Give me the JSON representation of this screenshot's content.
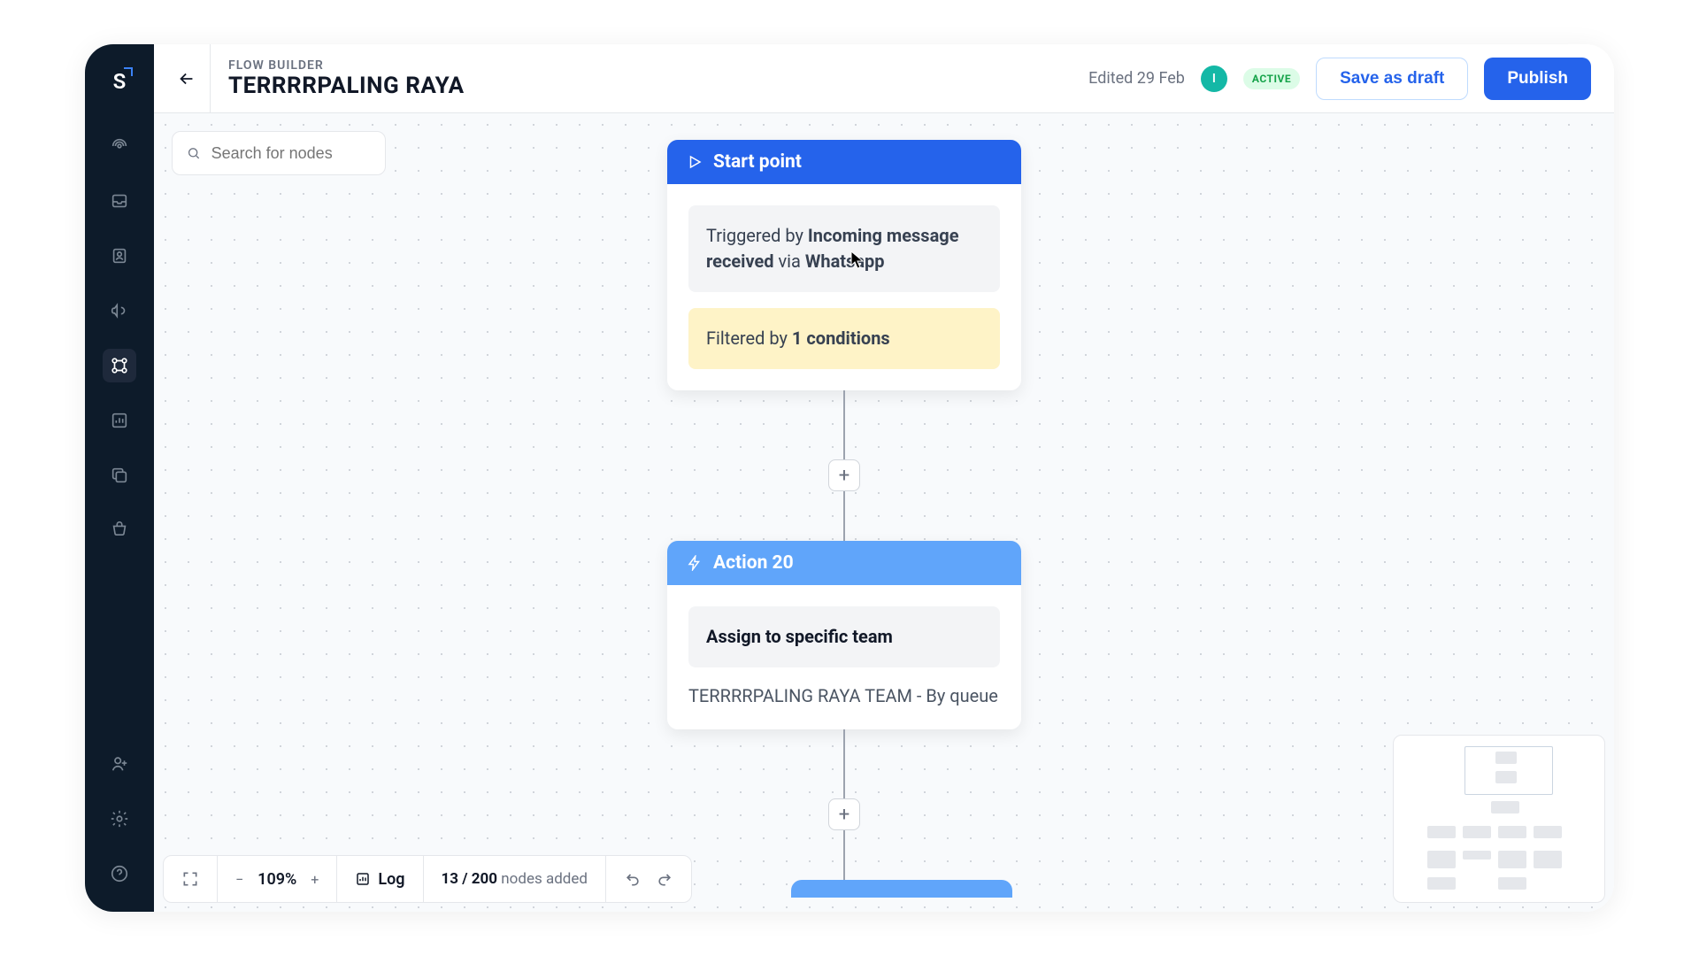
{
  "header": {
    "breadcrumb": "FLOW BUILDER",
    "title": "TERRRRPALING RAYA",
    "edited": "Edited 29 Feb",
    "avatar_initial": "I",
    "status": "ACTIVE",
    "save_label": "Save as draft",
    "publish_label": "Publish"
  },
  "search": {
    "placeholder": "Search for nodes"
  },
  "nodes": {
    "start": {
      "title": "Start point",
      "trigger_prefix": "Triggered by ",
      "trigger_event": "Incoming message received",
      "trigger_via": " via ",
      "trigger_channel": "Whatsapp",
      "filter_prefix": "Filtered by ",
      "filter_count": "1 conditions"
    },
    "action1": {
      "title": "Action 20",
      "action_label": "Assign to specific team",
      "detail": "TERRRRPALING RAYA TEAM - By queue"
    }
  },
  "toolbar": {
    "zoom": "109%",
    "log": "Log",
    "node_count": "13 / 200",
    "node_count_label": " nodes added"
  },
  "sidebar_icons": [
    "broadcast",
    "inbox",
    "contact",
    "megaphone",
    "flow",
    "analytics",
    "copy",
    "cart"
  ],
  "sidebar_bottom": [
    "user-add",
    "settings",
    "help"
  ]
}
